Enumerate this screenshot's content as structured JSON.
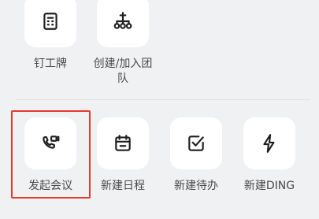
{
  "top_row": [
    {
      "label": "钉工牌",
      "icon": "badge-icon"
    },
    {
      "label_line1": "创建/加入团",
      "label_line2": "队",
      "icon": "org-structure-icon"
    }
  ],
  "bottom_row": [
    {
      "label": "发起会议",
      "icon": "video-call-icon",
      "highlighted": true
    },
    {
      "label": "新建日程",
      "icon": "calendar-icon"
    },
    {
      "label": "新建待办",
      "icon": "checkbox-icon"
    },
    {
      "label": "新建DING",
      "icon": "lightning-icon"
    }
  ],
  "colors": {
    "background": "#f0f1f3",
    "tile": "#ffffff",
    "highlight_border": "#e8392f",
    "label_text": "#4a4a4a"
  }
}
